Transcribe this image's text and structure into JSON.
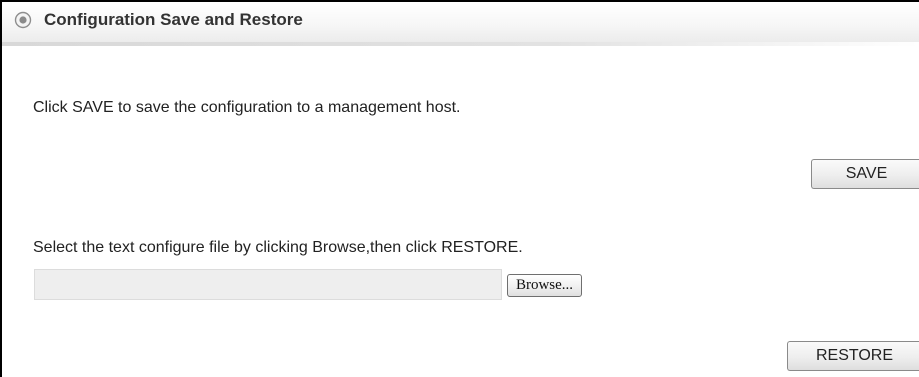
{
  "panel": {
    "title": "Configuration Save and Restore",
    "icon": "radio-target-icon"
  },
  "save_section": {
    "description": "Click SAVE to save the configuration to a management host.",
    "save_label": "SAVE"
  },
  "restore_section": {
    "description": "Select the text configure file by clicking Browse,then click RESTORE.",
    "file_value": "",
    "browse_label": "Browse...",
    "restore_label": "RESTORE"
  },
  "colors": {
    "header_title": "#333333",
    "body_text": "#222222",
    "file_input_bg": "#eeeeee"
  }
}
